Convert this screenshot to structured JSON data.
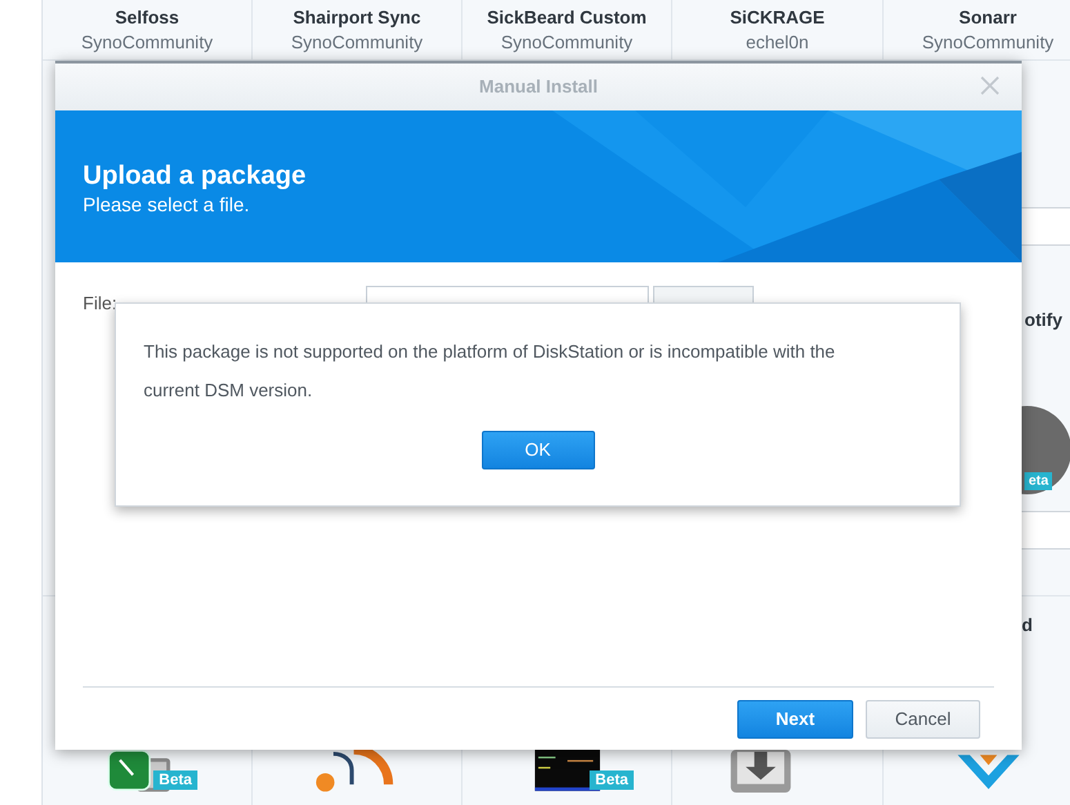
{
  "background": {
    "top_packages": [
      {
        "name": "Selfoss",
        "publisher": "SynoCommunity"
      },
      {
        "name": "Shairport Sync",
        "publisher": "SynoCommunity"
      },
      {
        "name": "SickBeard Custom",
        "publisher": "SynoCommunity"
      },
      {
        "name": "SiCKRAGE",
        "publisher": "echel0n"
      },
      {
        "name": "Sonarr",
        "publisher": "SynoCommunity"
      }
    ],
    "right_name": "otify",
    "right_badge": "eta",
    "lower_right_name": "d",
    "bottom_icons": [
      {
        "kind": "phone",
        "badge": "Beta"
      },
      {
        "kind": "feed"
      },
      {
        "kind": "terminal",
        "badge": "Beta"
      },
      {
        "kind": "download"
      },
      {
        "kind": "vee"
      }
    ]
  },
  "dialog": {
    "title": "Manual Install",
    "heading": "Upload a package",
    "subheading": "Please select a file.",
    "file_label": "File:",
    "buttons": [
      {
        "label": "Next",
        "kind": "primary"
      },
      {
        "label": "Cancel",
        "kind": "default"
      }
    ]
  },
  "alert": {
    "message": "This package is not supported on the platform of DiskStation or is incompatible with the current DSM version.",
    "button": "OK"
  }
}
